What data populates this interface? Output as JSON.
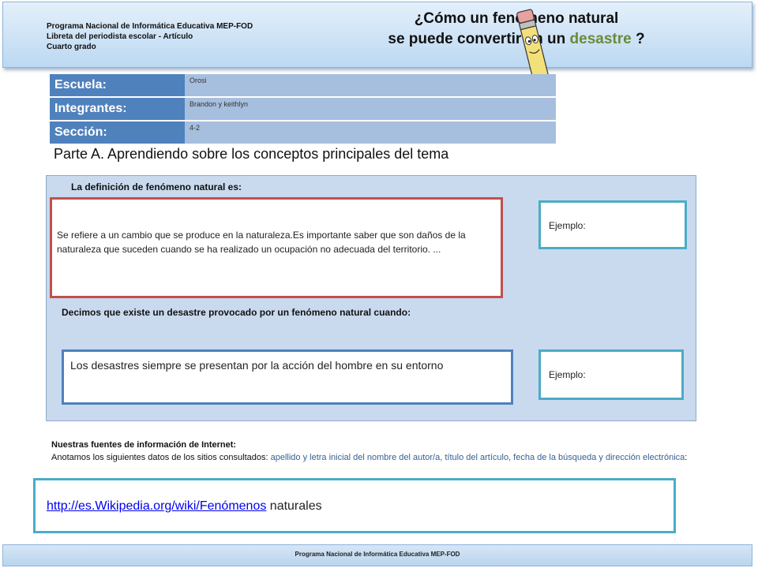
{
  "header": {
    "program": "Programa Nacional de Informática Educativa MEP-FOD",
    "notebook": "Libreta del periodista escolar -  Artículo",
    "grade": "Cuarto grado",
    "title_line1": "¿Cómo un fenómeno natural",
    "title_line2_pre": "se puede convertir en un ",
    "title_line2_accent": "desastre",
    "title_line2_post": " ?",
    "icon": "pencil-mascot-icon",
    "accent_color": "#6b8a3a"
  },
  "info": {
    "rows": [
      {
        "label": "Escuela:",
        "value": "Orosi"
      },
      {
        "label": "Integrantes:",
        "value": "Brandon y keithlyn"
      },
      {
        "label": "Sección:",
        "value": "4-2"
      }
    ]
  },
  "part_a": "Parte A.  Aprendiendo sobre los conceptos principales del tema",
  "definition": {
    "label": "La definición de  fenómeno natural es:",
    "text": "Se refiere a un cambio que se produce en la naturaleza.Es importante saber que son daños  de la naturaleza que suceden cuando se ha realizado un ocupación no adecuada del territorio. ...",
    "example": "Ejemplo:"
  },
  "disaster": {
    "label": "Decimos que existe un desastre provocado por un fenómeno natural cuando:",
    "text": "Los desastres siempre se presentan por la acción del hombre en su entorno",
    "example": "Ejemplo:"
  },
  "sources": {
    "title": "Nuestras fuentes de información de Internet:",
    "intro": "Anotamos los siguientes datos de los sitios consultados: ",
    "fields": "apellido y letra inicial del nombre del autor/a,  título del artículo, fecha de la búsqueda y dirección electrónica",
    "colon": ":",
    "url": "http://es.Wikipedia.org/wiki/Fenómenos",
    "url_suffix": " naturales"
  },
  "footer": "Programa  Nacional de Informática  Educativa MEP-FOD"
}
